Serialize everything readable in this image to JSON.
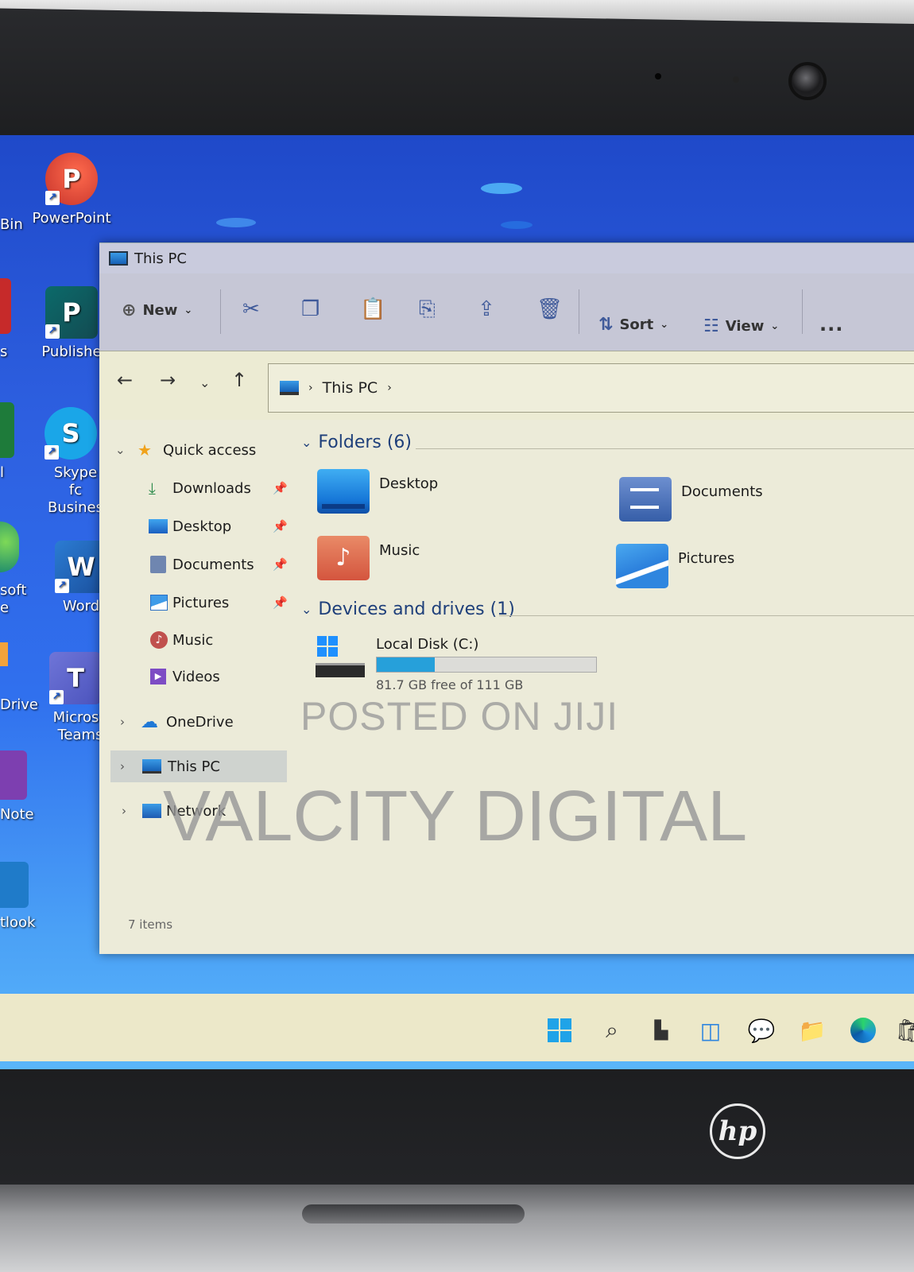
{
  "window": {
    "title": "This PC",
    "toolbar": {
      "new_label": "New",
      "sort_label": "Sort",
      "view_label": "View",
      "more_label": "..."
    },
    "address": {
      "path": "This PC"
    },
    "nav": {
      "quick_access": "Quick access",
      "items": [
        {
          "label": "Downloads"
        },
        {
          "label": "Desktop"
        },
        {
          "label": "Documents"
        },
        {
          "label": "Pictures"
        },
        {
          "label": "Music"
        },
        {
          "label": "Videos"
        }
      ],
      "onedrive": "OneDrive",
      "this_pc": "This PC",
      "network": "Network"
    },
    "folders_header": "Folders (6)",
    "folders": [
      {
        "name": "Desktop"
      },
      {
        "name": "Documents"
      },
      {
        "name": "Music"
      },
      {
        "name": "Pictures"
      }
    ],
    "devices_header": "Devices and drives (1)",
    "drive": {
      "name": "Local Disk (C:)",
      "free_text": "81.7 GB free of 111 GB",
      "used_fraction": 0.264
    },
    "status": "7 items"
  },
  "desktop": {
    "icons": [
      {
        "label": "PowerPoint"
      },
      {
        "label": "Publishe"
      },
      {
        "label": "Skype fc Busines"
      },
      {
        "label": "Word"
      },
      {
        "label": "Microso Teams"
      }
    ],
    "cut_labels": [
      "Bin",
      "s",
      "l",
      "soft e",
      "Drive",
      "Note",
      "tlook"
    ]
  },
  "watermark": {
    "line1": "POSTED ON JIJI",
    "line2": "VALCITY DIGITAL"
  },
  "brand": {
    "laptop_logo": "hp"
  },
  "colors": {
    "accent": "#26a0da",
    "window_bg": "#ecebd9",
    "toolbar_bg": "#c6c7d6",
    "desktop_blue": "#2d5fe0"
  }
}
